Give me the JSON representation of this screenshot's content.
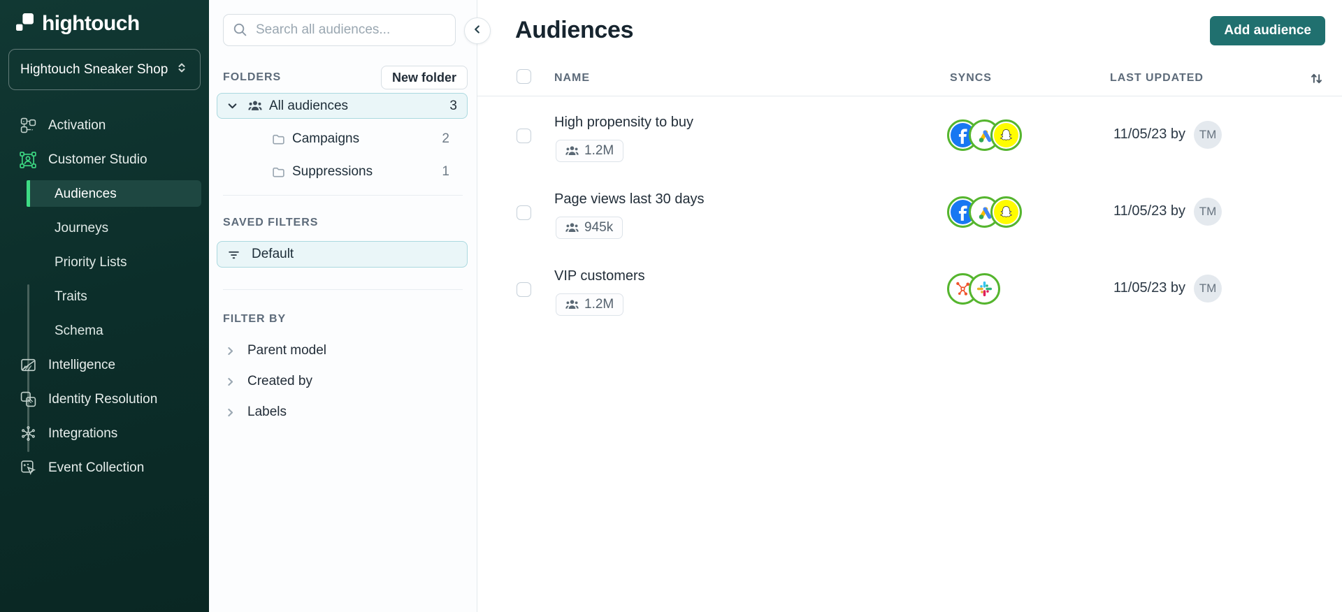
{
  "sidebar": {
    "brand": "hightouch",
    "workspace": "Hightouch Sneaker Shop",
    "items": [
      {
        "label": "Activation",
        "icon": "workflow-icon"
      },
      {
        "label": "Customer Studio",
        "icon": "customer-studio-icon"
      },
      {
        "label": "Audiences",
        "active": true
      },
      {
        "label": "Journeys"
      },
      {
        "label": "Priority Lists"
      },
      {
        "label": "Traits"
      },
      {
        "label": "Schema"
      },
      {
        "label": "Intelligence",
        "icon": "intelligence-icon"
      },
      {
        "label": "Identity Resolution",
        "icon": "identity-icon"
      },
      {
        "label": "Integrations",
        "icon": "integrations-icon"
      },
      {
        "label": "Event Collection",
        "icon": "event-collection-icon"
      }
    ]
  },
  "panel": {
    "search_placeholder": "Search all audiences...",
    "folders_label": "FOLDERS",
    "new_folder_button": "New folder",
    "folders": [
      {
        "name": "All audiences",
        "count": "3",
        "selected": true,
        "icon": "people-icon"
      },
      {
        "name": "Campaigns",
        "count": "2",
        "icon": "folder-icon"
      },
      {
        "name": "Suppressions",
        "count": "1",
        "icon": "folder-icon"
      }
    ],
    "saved_filters_label": "SAVED FILTERS",
    "saved_filters": [
      {
        "label": "Default",
        "icon": "filter-icon"
      }
    ],
    "filter_by_label": "FILTER BY",
    "filter_groups": [
      {
        "label": "Parent model"
      },
      {
        "label": "Created by"
      },
      {
        "label": "Labels"
      }
    ]
  },
  "main": {
    "title": "Audiences",
    "add_button": "Add audience",
    "columns": {
      "name": "NAME",
      "syncs": "SYNCS",
      "last_updated": "LAST UPDATED"
    },
    "rows": [
      {
        "name": "High propensity to buy",
        "size": "1.2M",
        "syncs": [
          "facebook",
          "google-ads",
          "snapchat"
        ],
        "updated": "11/05/23 by",
        "avatar": "TM"
      },
      {
        "name": "Page views last 30 days",
        "size": "945k",
        "syncs": [
          "facebook",
          "google-ads",
          "snapchat"
        ],
        "updated": "11/05/23 by",
        "avatar": "TM"
      },
      {
        "name": "VIP customers",
        "size": "1.2M",
        "syncs": [
          "hubspot",
          "slack"
        ],
        "updated": "11/05/23 by",
        "avatar": "TM"
      }
    ]
  },
  "colors": {
    "accent_green": "#3EDC85",
    "brand_teal": "#20706F",
    "sidebar_bg": "#0C2E2A",
    "selected_bg": "#EAF6F8",
    "selected_border": "#ABD9DF",
    "sync_ring_green": "#55B52E",
    "facebook_blue": "#1877F2",
    "snapchat_yellow": "#FFFC00",
    "hubspot_orange": "#F0532D",
    "slack": [
      "#36C5F0",
      "#2EB67D",
      "#ECB22E",
      "#E01E5A"
    ]
  }
}
